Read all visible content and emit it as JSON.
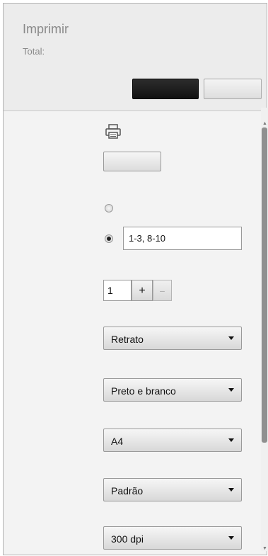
{
  "header": {
    "title": "Imprimir",
    "total_label": "Total:",
    "primary_button_label": "",
    "secondary_button_label": ""
  },
  "destination": {
    "icon": "printer-icon",
    "button_label": ""
  },
  "pages": {
    "all_selected": false,
    "custom_selected": true,
    "custom_value": "1-3, 8-10"
  },
  "copies": {
    "value": "1",
    "increment_label": "+",
    "decrement_label": "−"
  },
  "layout": {
    "selected": "Retrato"
  },
  "color": {
    "selected": "Preto e branco"
  },
  "paper_size": {
    "selected": "A4"
  },
  "margins": {
    "selected": "Padrão"
  },
  "quality": {
    "selected": "300 dpi"
  }
}
